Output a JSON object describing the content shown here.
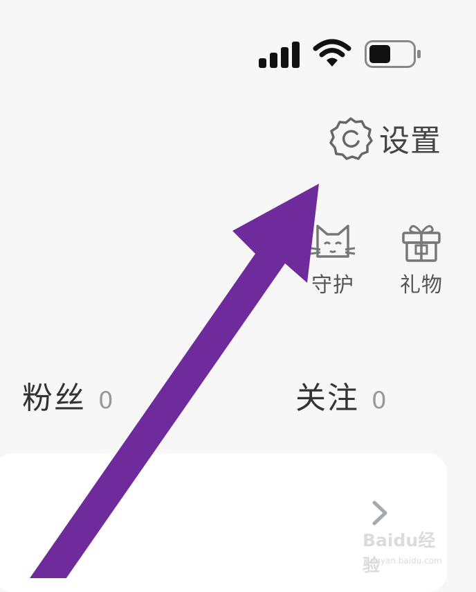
{
  "status_bar": {
    "signal_icon": "cellular-signal-icon",
    "wifi_icon": "wifi-icon",
    "battery_icon": "battery-icon"
  },
  "header": {
    "settings_label": "设置",
    "settings_icon": "gear-icon"
  },
  "quick_actions": [
    {
      "label": "守护",
      "icon": "cat-guard-icon"
    },
    {
      "label": "礼物",
      "icon": "gift-icon"
    }
  ],
  "stats": [
    {
      "label": "粉丝",
      "count": "0"
    },
    {
      "label": "关注",
      "count": "0"
    }
  ],
  "card": {
    "chevron_icon": "chevron-right-icon"
  },
  "watermark": {
    "logo": "Baidu经验",
    "site": "jingyan.baidu.com"
  },
  "annotation": {
    "arrow_color": "#6f2a9c",
    "icon": "arrow-annotation-icon"
  }
}
